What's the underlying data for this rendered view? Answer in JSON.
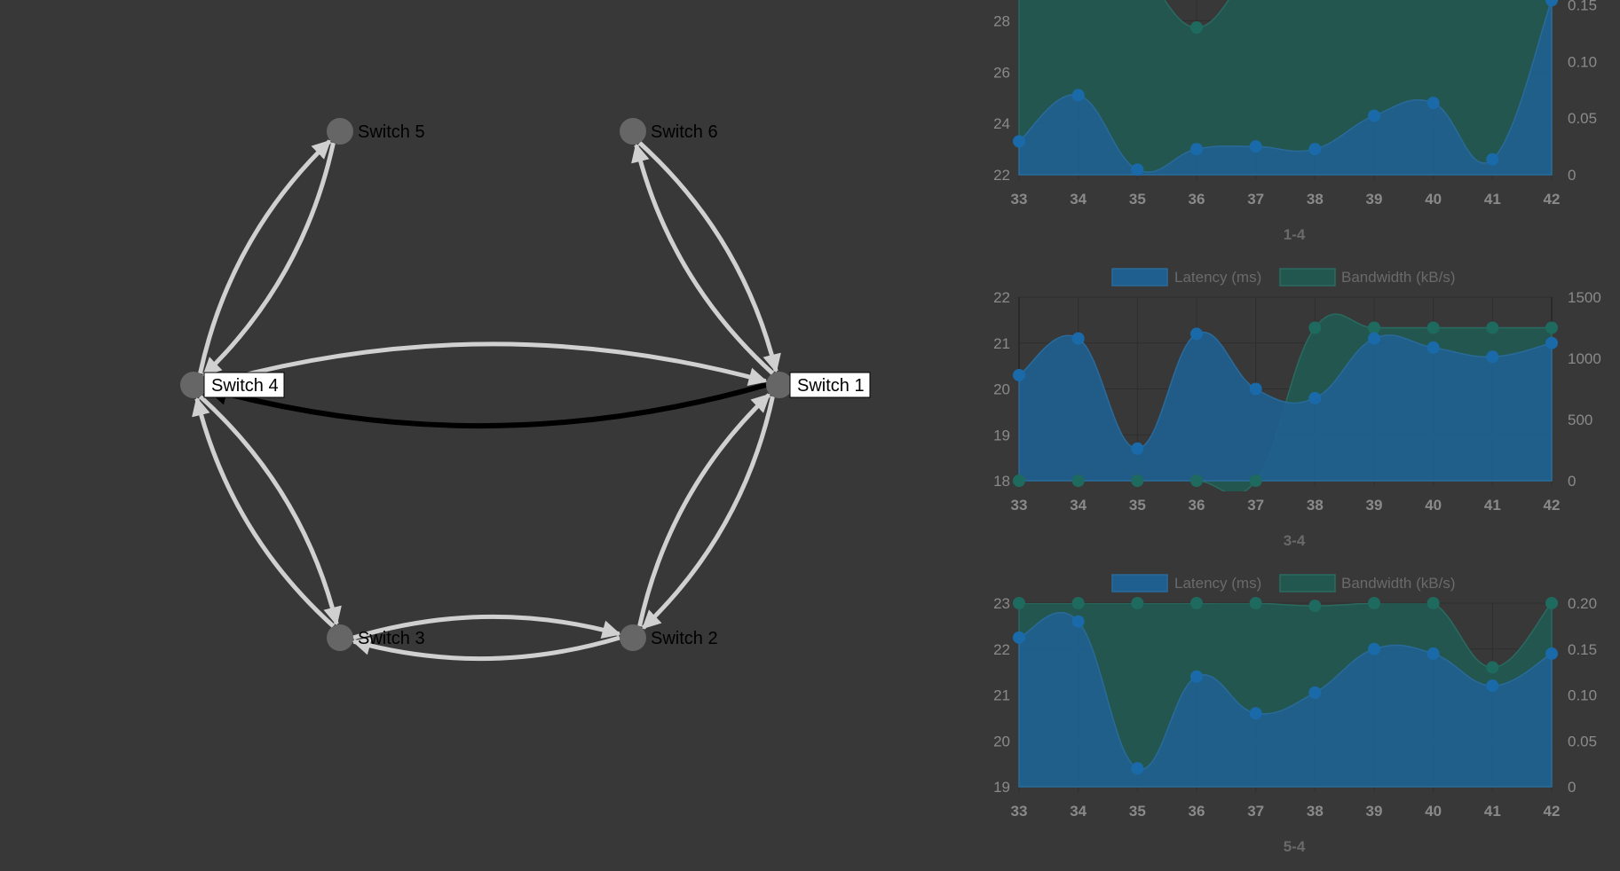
{
  "graph": {
    "nodes": [
      {
        "id": "s5",
        "label": "Switch 5",
        "highlighted": false
      },
      {
        "id": "s6",
        "label": "Switch 6",
        "highlighted": false
      },
      {
        "id": "s4",
        "label": "Switch 4",
        "highlighted": true
      },
      {
        "id": "s1",
        "label": "Switch 1",
        "highlighted": true
      },
      {
        "id": "s3",
        "label": "Switch 3",
        "highlighted": false
      },
      {
        "id": "s2",
        "label": "Switch 2",
        "highlighted": false
      }
    ],
    "edges": [
      {
        "from": "s4",
        "to": "s5",
        "selected": false
      },
      {
        "from": "s5",
        "to": "s4",
        "selected": false
      },
      {
        "from": "s1",
        "to": "s6",
        "selected": false
      },
      {
        "from": "s6",
        "to": "s1",
        "selected": false
      },
      {
        "from": "s4",
        "to": "s1",
        "selected": false
      },
      {
        "from": "s1",
        "to": "s4",
        "selected": true
      },
      {
        "from": "s4",
        "to": "s3",
        "selected": false
      },
      {
        "from": "s3",
        "to": "s4",
        "selected": false
      },
      {
        "from": "s1",
        "to": "s2",
        "selected": false
      },
      {
        "from": "s2",
        "to": "s1",
        "selected": false
      },
      {
        "from": "s3",
        "to": "s2",
        "selected": false
      },
      {
        "from": "s2",
        "to": "s3",
        "selected": false
      }
    ]
  },
  "colors": {
    "background": "#383838",
    "node": "#666666",
    "edge": "#d0d0d0",
    "edge_selected": "#000000",
    "latency_fill": "#1f5f8f",
    "latency_point": "#1a6aaa",
    "bandwidth_fill": "#22574f",
    "bandwidth_point": "#1f6a5e",
    "axis_text": "#8a8a8a",
    "grid": "#2e2e2e"
  },
  "chart_data": [
    {
      "type": "area",
      "title": "1-4",
      "legend": [],
      "x": [
        33,
        34,
        35,
        36,
        37,
        38,
        39,
        40,
        41,
        42
      ],
      "y_left_ticks": [
        22,
        24,
        26,
        28
      ],
      "y_right_ticks": [
        "0",
        "0.05",
        "0.10",
        "0.15"
      ],
      "ylim_left": [
        22,
        29.5
      ],
      "ylim_right": [
        0,
        0.17
      ],
      "series": [
        {
          "name": "Latency (ms)",
          "axis": "left",
          "values": [
            23.3,
            25.1,
            22.2,
            23.0,
            23.1,
            23.0,
            24.3,
            24.8,
            22.6,
            28.8
          ]
        },
        {
          "name": "Bandwidth (kB/s)",
          "axis": "right",
          "values": [
            0.18,
            0.18,
            0.18,
            0.13,
            0.18,
            0.18,
            0.18,
            0.18,
            0.18,
            0.18
          ]
        }
      ]
    },
    {
      "type": "area",
      "title": "3-4",
      "legend": [
        "Latency (ms)",
        "Bandwidth (kB/s)"
      ],
      "x": [
        33,
        34,
        35,
        36,
        37,
        38,
        39,
        40,
        41,
        42
      ],
      "y_left_ticks": [
        18,
        19,
        20,
        21,
        22
      ],
      "y_right_ticks": [
        "0",
        "500",
        "1000",
        "1500"
      ],
      "ylim_left": [
        18,
        22
      ],
      "ylim_right": [
        0,
        1500
      ],
      "series": [
        {
          "name": "Latency (ms)",
          "axis": "left",
          "values": [
            20.3,
            21.1,
            18.7,
            21.2,
            20.0,
            19.8,
            21.1,
            20.9,
            20.7,
            21.0
          ]
        },
        {
          "name": "Bandwidth (kB/s)",
          "axis": "right",
          "values": [
            0,
            0,
            0,
            0,
            0,
            1250,
            1250,
            1250,
            1250,
            1250
          ]
        }
      ]
    },
    {
      "type": "area",
      "title": "5-4",
      "legend": [
        "Latency (ms)",
        "Bandwidth (kB/s)"
      ],
      "x": [
        33,
        34,
        35,
        36,
        37,
        38,
        39,
        40,
        41,
        42
      ],
      "y_left_ticks": [
        19,
        20,
        21,
        22,
        23
      ],
      "y_right_ticks": [
        "0",
        "0.05",
        "0.10",
        "0.15",
        "0.20"
      ],
      "ylim_left": [
        19,
        23
      ],
      "ylim_right": [
        0,
        0.2
      ],
      "series": [
        {
          "name": "Latency (ms)",
          "axis": "left",
          "values": [
            22.25,
            22.6,
            19.4,
            21.4,
            20.6,
            21.05,
            22.0,
            21.9,
            21.2,
            21.9
          ]
        },
        {
          "name": "Bandwidth (kB/s)",
          "axis": "right",
          "values": [
            0.2,
            0.2,
            0.2,
            0.2,
            0.2,
            0.197,
            0.2,
            0.2,
            0.13,
            0.2
          ]
        }
      ]
    }
  ]
}
